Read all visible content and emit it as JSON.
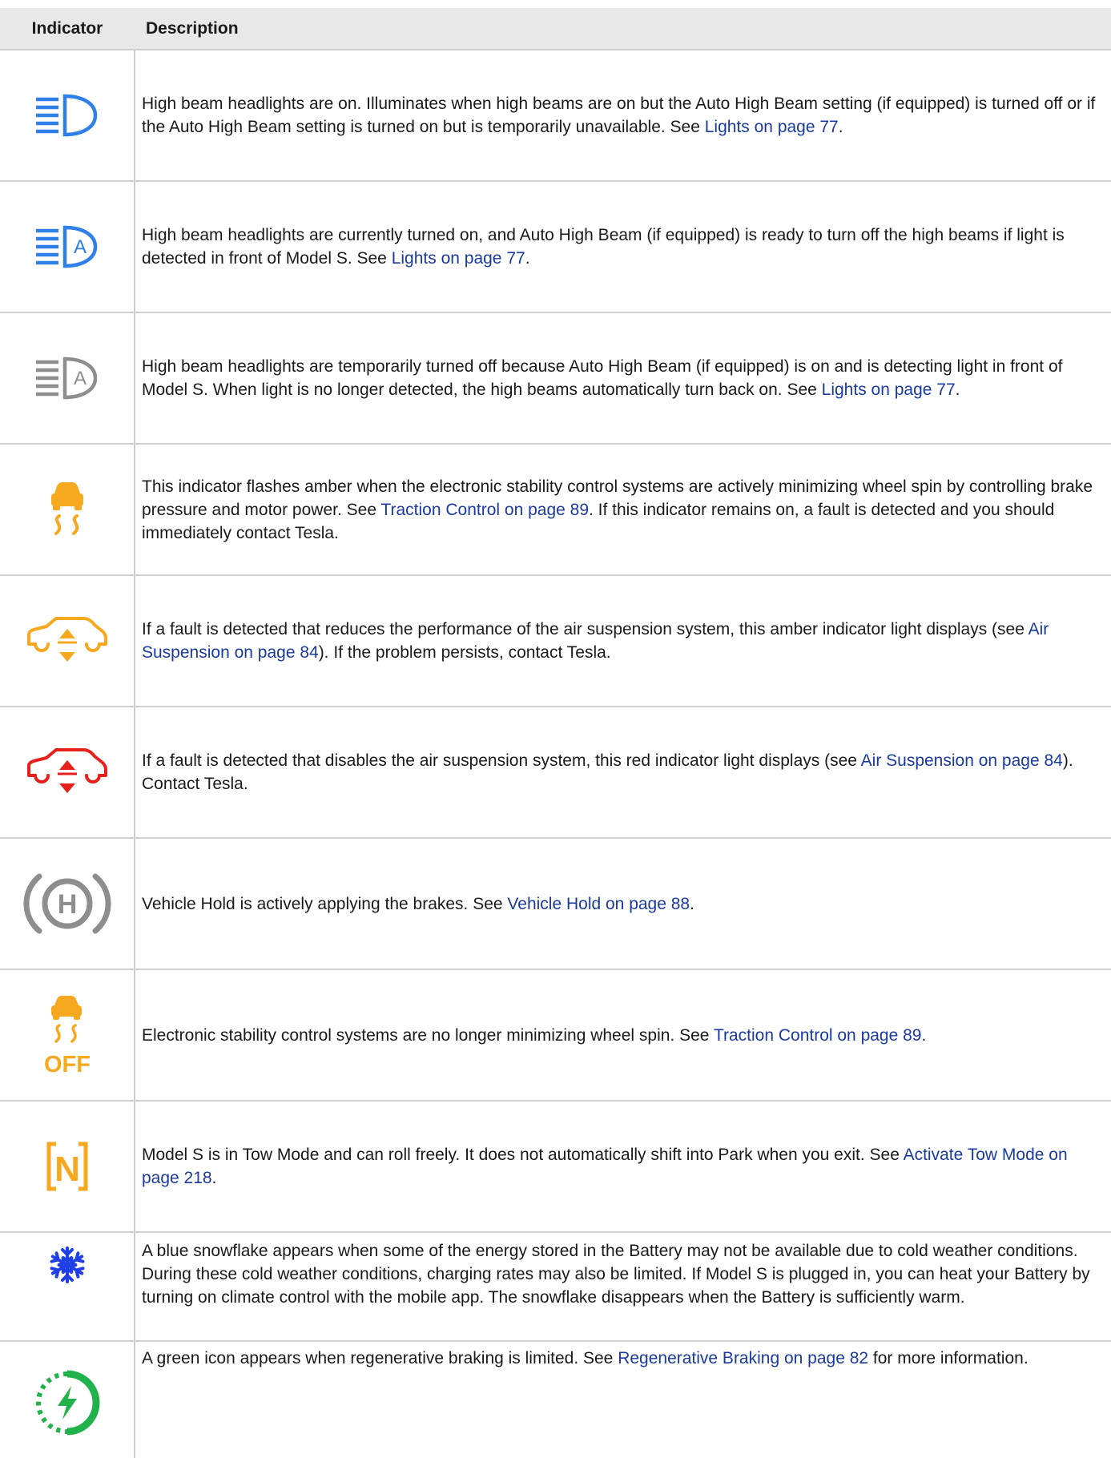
{
  "header": {
    "indicator": "Indicator",
    "description": "Description"
  },
  "colors": {
    "blue": "#2f80e8",
    "gray": "#8e8e8e",
    "amber": "#f6a91e",
    "red": "#e8201c",
    "green": "#22b24c",
    "snowflake": "#1f3fe6",
    "link": "#1a3a9e"
  },
  "rows": [
    {
      "icon": "high-beam-icon",
      "text1": "High beam headlights are on. Illuminates when high beams are on but the Auto High Beam setting (if equipped) is turned off or if the Auto High Beam setting is turned on but is temporarily unavailable. See ",
      "link": "Lights on page 77",
      "text2": "."
    },
    {
      "icon": "auto-high-beam-ready-icon",
      "text1": "High beam headlights are currently turned on, and Auto High Beam (if equipped) is ready to turn off the high beams if light is detected in front of Model S. See ",
      "link": "Lights on page 77",
      "text2": "."
    },
    {
      "icon": "auto-high-beam-off-icon",
      "text1": "High beam headlights are temporarily turned off because Auto High Beam (if equipped) is on and is detecting light in front of Model S. When light is no longer detected, the high beams automatically turn back on. See ",
      "link": "Lights on page 77",
      "text2": "."
    },
    {
      "icon": "traction-control-icon",
      "text1": "This indicator flashes amber when the electronic stability control systems are actively minimizing wheel spin by controlling brake pressure and motor power. See ",
      "link": "Traction Control on page 89",
      "text2": ". If this indicator remains on, a fault is detected and you should immediately contact Tesla."
    },
    {
      "icon": "air-suspension-amber-icon",
      "text1": "If a fault is detected that reduces the performance of the air suspension system, this amber indicator light displays (see ",
      "link": "Air Suspension on page 84",
      "text2": "). If the problem persists, contact Tesla."
    },
    {
      "icon": "air-suspension-red-icon",
      "text1": "If a fault is detected that disables the air suspension system, this red indicator light displays (see ",
      "link": "Air Suspension on page 84",
      "text2": "). Contact Tesla."
    },
    {
      "icon": "vehicle-hold-icon",
      "icon_text": "H",
      "text1": "Vehicle Hold is actively applying the brakes. See ",
      "link": "Vehicle Hold on page 88",
      "text2": "."
    },
    {
      "icon": "traction-control-off-icon",
      "icon_text": "OFF",
      "text1": "Electronic stability control systems are no longer minimizing wheel spin. See ",
      "link": "Traction Control on page 89",
      "text2": "."
    },
    {
      "icon": "tow-mode-icon",
      "icon_text": "N",
      "text1": "Model S is in Tow Mode and can roll freely. It does not automatically shift into Park when you exit. See ",
      "link": "Activate Tow Mode on page 218",
      "text2": "."
    },
    {
      "icon": "snowflake-icon",
      "text1": "A blue snowflake appears when some of the energy stored in the Battery may not be available due to cold weather conditions. During these cold weather conditions, charging rates may also be limited. If Model S is plugged in, you can heat your Battery by turning on climate control with the mobile app. The snowflake disappears when the Battery is sufficiently warm.",
      "link": "",
      "text2": ""
    },
    {
      "icon": "regen-braking-limited-icon",
      "text1": "A green icon appears when regenerative braking is limited. See ",
      "link": "Regenerative Braking on page 82",
      "text2": " for more information."
    }
  ]
}
